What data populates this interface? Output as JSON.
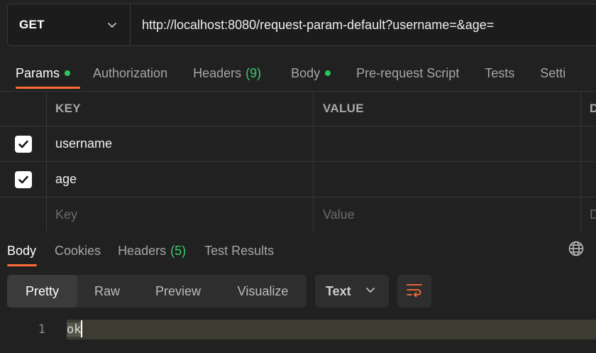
{
  "request": {
    "method": "GET",
    "url": "http://localhost:8080/request-param-default?username=&age="
  },
  "request_tabs": [
    {
      "label": "Params",
      "indicator": "dot",
      "active": true
    },
    {
      "label": "Authorization"
    },
    {
      "label": "Headers",
      "count": "(9)"
    },
    {
      "label": "Body",
      "indicator": "dot"
    },
    {
      "label": "Pre-request Script"
    },
    {
      "label": "Tests"
    },
    {
      "label": "Setti"
    }
  ],
  "params": {
    "headers": {
      "key": "KEY",
      "value": "VALUE",
      "desc": "D"
    },
    "rows": [
      {
        "checked": true,
        "key": "username",
        "value": ""
      },
      {
        "checked": true,
        "key": "age",
        "value": ""
      }
    ],
    "placeholder": {
      "key": "Key",
      "value": "Value",
      "desc": "D"
    }
  },
  "response_tabs": [
    {
      "label": "Body",
      "active": true
    },
    {
      "label": "Cookies"
    },
    {
      "label": "Headers",
      "count": "(5)"
    },
    {
      "label": "Test Results"
    }
  ],
  "view_modes": [
    "Pretty",
    "Raw",
    "Preview",
    "Visualize"
  ],
  "active_view": "Pretty",
  "format": "Text",
  "body_lines": [
    {
      "num": "1",
      "text": "ok"
    }
  ],
  "colors": {
    "accent": "#ff6c37",
    "success": "#2bc55d"
  },
  "icons": [
    "chevron-down-icon",
    "checkbox-checked-icon",
    "globe-icon",
    "wrap-lines-icon"
  ]
}
